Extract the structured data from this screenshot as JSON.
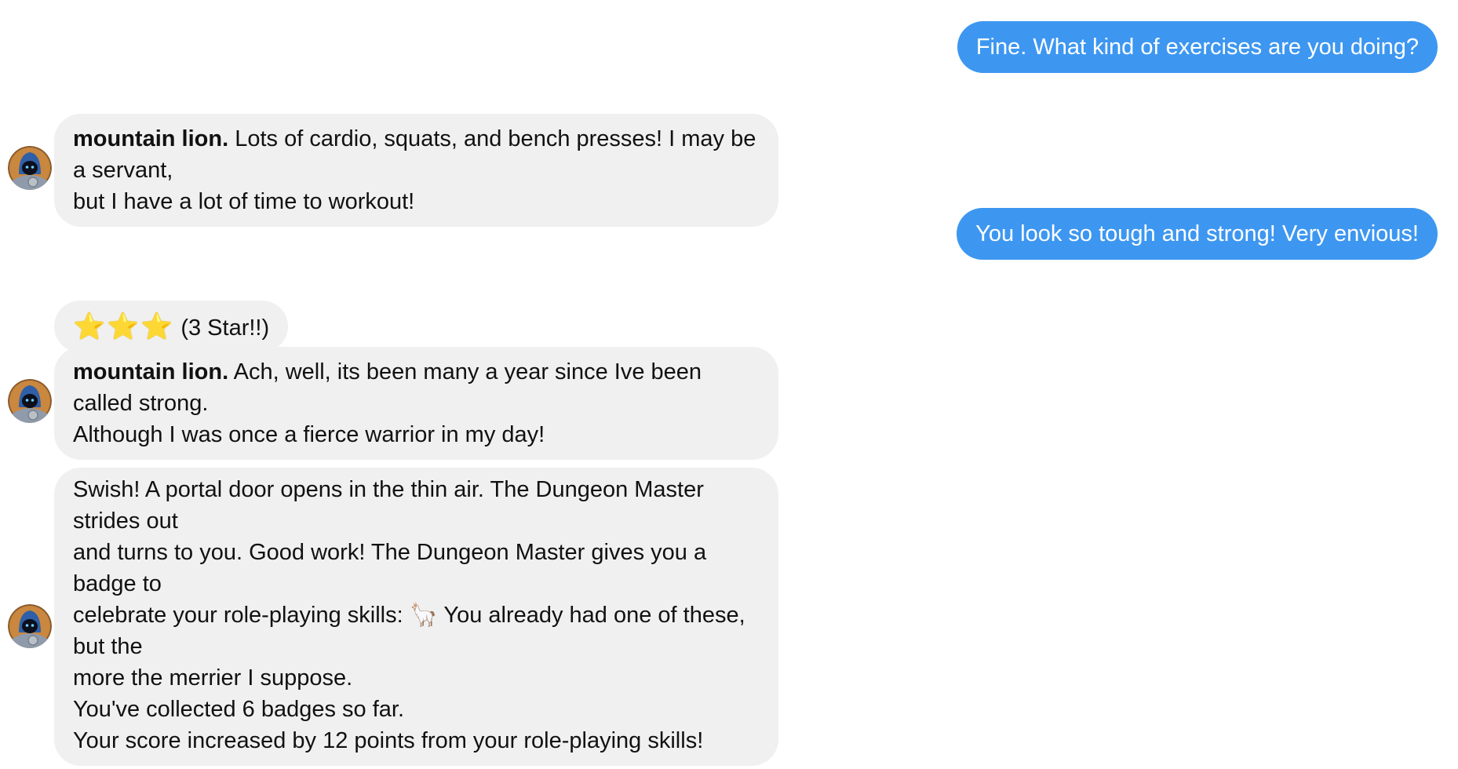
{
  "messages": [
    {
      "role": "user",
      "text": "Fine. What kind of exercises are you doing?"
    },
    {
      "role": "bot",
      "speaker": "mountain lion.",
      "lines": [
        "Lots of cardio, squats, and bench presses! I may be a servant,",
        "but I have a lot of time to workout!"
      ]
    },
    {
      "role": "user",
      "text": "You look so tough and strong! Very envious!"
    },
    {
      "role": "rating",
      "stars": "⭐⭐⭐",
      "label": "(3 Star!!)"
    },
    {
      "role": "bot",
      "speaker": "mountain lion.",
      "lines": [
        "Ach, well, its been many a year since Ive been called strong.",
        "Although I was once a fierce warrior in my day!"
      ]
    },
    {
      "role": "bot",
      "lines": [
        "Swish! A portal door opens in the thin air. The Dungeon Master strides out",
        "and turns to you. Good work! The Dungeon Master gives you a badge to",
        "celebrate your role-playing skills: 🦙 You already had one of these, but the",
        "more the merrier I suppose.",
        "You've collected 6 badges so far.",
        "Your score increased by 12 points from your role-playing skills!"
      ]
    }
  ],
  "colors": {
    "user_bubble": "#3d97f1",
    "bot_bubble": "#f0f0f0"
  },
  "icons": {
    "avatar": "hooded-character-avatar",
    "badge": "llama-emoji",
    "rating": "star-emoji"
  }
}
